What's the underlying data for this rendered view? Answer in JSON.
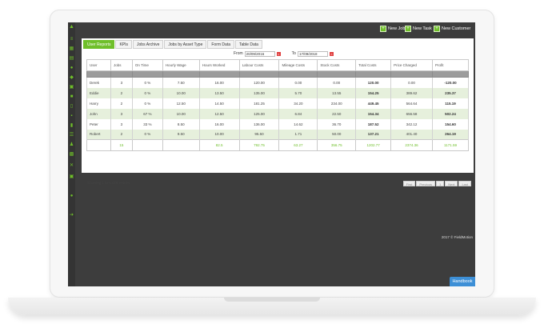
{
  "header": {
    "buttons": [
      {
        "label": "New Job",
        "icon": "new-job-icon"
      },
      {
        "label": "New Task",
        "icon": "new-task-icon"
      },
      {
        "label": "New Customer",
        "icon": "new-customer-icon"
      }
    ]
  },
  "tabs": [
    {
      "label": "User Reports",
      "active": true
    },
    {
      "label": "KPIs"
    },
    {
      "label": "Jobs Archive"
    },
    {
      "label": "Jobs by Asset Type"
    },
    {
      "label": "Form Data"
    },
    {
      "label": "Table Data"
    }
  ],
  "range": {
    "from_label": "From",
    "from_value": "20/09/2016",
    "to_label": "To",
    "to_value": "17/09/2018"
  },
  "table": {
    "columns": [
      "User",
      "Jobs",
      "On Time",
      "Hourly Wage",
      "Hours Worked",
      "Labour Costs",
      "Mileage Costs",
      "Stock Costs",
      "Total Costs",
      "Price Charged",
      "Profit"
    ],
    "rows": [
      [
        "Derek",
        "3",
        "0 %",
        "7.50",
        "16.00",
        "120.00",
        "0.00",
        "0.00",
        "120.00",
        "0.00",
        "-120.00"
      ],
      [
        "Eddie",
        "2",
        "0 %",
        "10.00",
        "13.50",
        "135.00",
        "5.70",
        "13.55",
        "154.25",
        "389.62",
        "235.37"
      ],
      [
        "Harry",
        "2",
        "0 %",
        "12.50",
        "14.50",
        "181.25",
        "34.20",
        "234.00",
        "449.45",
        "564.64",
        "115.19"
      ],
      [
        "John",
        "3",
        "67 %",
        "10.00",
        "12.50",
        "125.00",
        "6.84",
        "22.50",
        "154.34",
        "656.58",
        "502.24"
      ],
      [
        "Peter",
        "3",
        "33 %",
        "8.50",
        "16.00",
        "136.00",
        "14.62",
        "36.70",
        "187.52",
        "342.12",
        "154.60"
      ],
      [
        "Robert",
        "2",
        "0 %",
        "9.50",
        "10.00",
        "95.50",
        "1.71",
        "50.00",
        "137.21",
        "401.40",
        "264.19"
      ]
    ],
    "totals": [
      "",
      "15",
      "",
      "",
      "82.5",
      "792.75",
      "63.27",
      "356.75",
      "1202.77",
      "2374.36",
      "1171.59"
    ]
  },
  "footer": {
    "info": "Showing 1 to 6 of 6 entries",
    "pager": [
      "First",
      "Previous",
      "1",
      "Next",
      "Last"
    ]
  },
  "copyright": "2017 © FieldMotion",
  "handbook": "Handbook",
  "colors": {
    "accent": "#6fbf2a",
    "handbook": "#3d8fd6"
  }
}
